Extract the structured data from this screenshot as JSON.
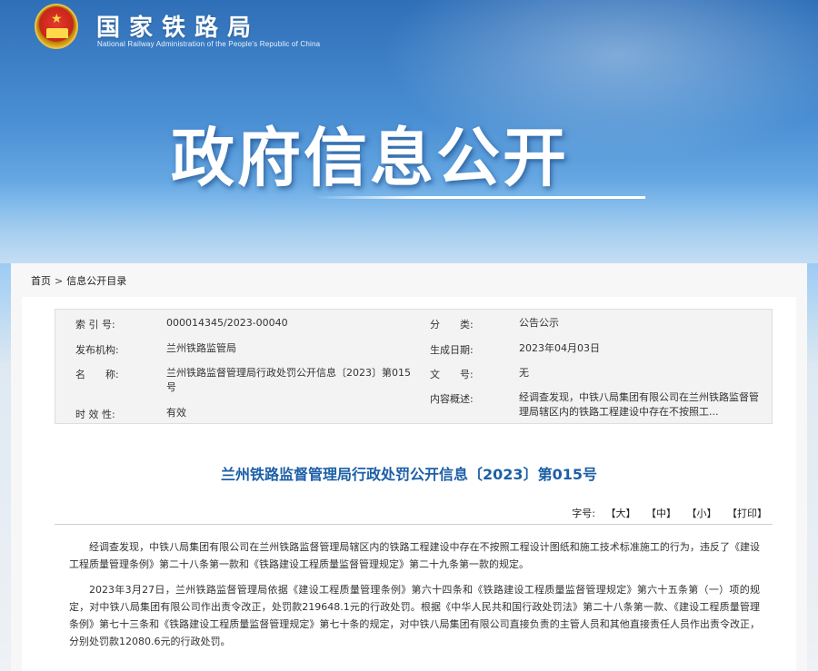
{
  "site": {
    "name": "国家铁路局",
    "english_name": "National Railway Administration of the People's Republic of China"
  },
  "banner": {
    "title": "政府信息公开"
  },
  "breadcrumb": {
    "home": "首页",
    "separator": ">",
    "current": "信息公开目录"
  },
  "meta": {
    "index_label": "索 引 号:",
    "index_value": "000014345/2023-00040",
    "category_label": "分　　类:",
    "category_value": "公告公示",
    "publisher_label": "发布机构:",
    "publisher_value": "兰州铁路监管局",
    "date_label": "生成日期:",
    "date_value": "2023年04月03日",
    "name_label": "名　　称:",
    "name_value": "兰州铁路监督管理局行政处罚公开信息〔2023〕第015号",
    "docno_label": "文　　号:",
    "docno_value": "无",
    "summary_label": "内容概述:",
    "summary_value": "经调查发现，中铁八局集团有限公司在兰州铁路监督管理局辖区内的铁路工程建设中存在不按照工...",
    "validity_label": "时 效 性:",
    "validity_value": "有效"
  },
  "document": {
    "title": "兰州铁路监督管理局行政处罚公开信息〔2023〕第015号",
    "font_size_label": "字号:",
    "font_large": "【大】",
    "font_medium": "【中】",
    "font_small": "【小】",
    "print": "【打印】",
    "paragraphs": [
      "经调查发现，中铁八局集团有限公司在兰州铁路监督管理局辖区内的铁路工程建设中存在不按照工程设计图纸和施工技术标准施工的行为，违反了《建设工程质量管理条例》第二十八条第一款和《铁路建设工程质量监督管理规定》第二十九条第一款的规定。",
      "2023年3月27日，兰州铁路监督管理局依据《建设工程质量管理条例》第六十四条和《铁路建设工程质量监督管理规定》第六十五条第（一）项的规定，对中铁八局集团有限公司作出责令改正，处罚款219648.1元的行政处罚。根据《中华人民共和国行政处罚法》第二十八条第一款、《建设工程质量管理条例》第七十三条和《铁路建设工程质量监督管理规定》第七十条的规定，对中铁八局集团有限公司直接负责的主管人员和其他直接责任人员作出责令改正，分别处罚款12080.6元的行政处罚。"
    ]
  }
}
